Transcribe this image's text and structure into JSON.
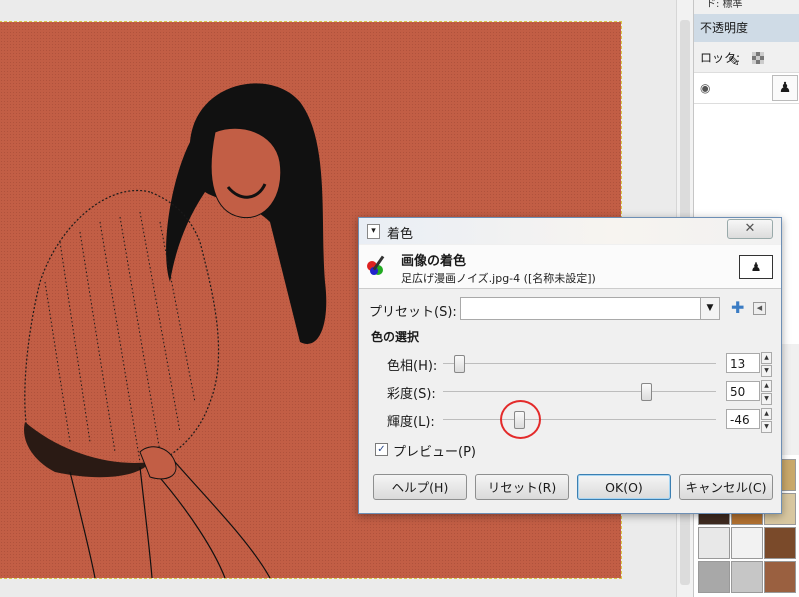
{
  "right_panel": {
    "mode_text": "ド: 標準",
    "opacity_label": "不透明度",
    "lock_label": "ロック:",
    "patterns_colors": [
      "#5a3a22",
      "#8a5030",
      "#c9a86a",
      "#3e2a20",
      "#b07030",
      "#d8c7a0",
      "#e8e8e8",
      "#f2f2f2",
      "#7a4a2a",
      "#a8a8a8",
      "#c6c6c6",
      "#9a6040"
    ]
  },
  "dialog": {
    "title": "着色",
    "header_title": "画像の着色",
    "header_subtitle": "足広げ漫画ノイズ.jpg-4 ([名称未設定])",
    "preset_label": "プリセット(S):",
    "preset_value": "",
    "section_title": "色の選択",
    "sliders": [
      {
        "label": "色相(H):",
        "value": "13",
        "level": 0.04
      },
      {
        "label": "彩度(S):",
        "value": "50",
        "level": 0.75
      },
      {
        "label": "輝度(L):",
        "value": "-46",
        "level": 0.27
      }
    ],
    "preview_label": "プレビュー(P)",
    "preview_checked": "✓",
    "buttons": {
      "help": "ヘルプ(H)",
      "reset": "リセット(R)",
      "ok": "OK(O)",
      "cancel": "キャンセル(C)"
    }
  },
  "colors": {
    "canvas_bg": "#c25e45",
    "annotation_circle": "#e32a2a",
    "accent": "#3b7cc4"
  }
}
